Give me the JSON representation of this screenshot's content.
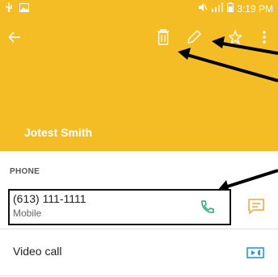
{
  "status_bar": {
    "time": "3:19 PM",
    "icons": [
      "usb-icon",
      "image-icon",
      "mute-icon",
      "signal-icon",
      "battery-icon"
    ]
  },
  "toolbar": {
    "icons": [
      "back-arrow-icon",
      "delete-icon",
      "edit-icon",
      "star-icon",
      "more-icon"
    ]
  },
  "contact": {
    "name": "Jotest Smith"
  },
  "phone_section": {
    "label": "PHONE",
    "number": "(613) 111-1111",
    "type": "Mobile"
  },
  "video_call": {
    "label": "Video call"
  },
  "colors": {
    "header": "#f5bd25",
    "call_icon": "#2eaa7a",
    "message_icon": "#f2a33b",
    "video_icon": "#2196f3"
  }
}
